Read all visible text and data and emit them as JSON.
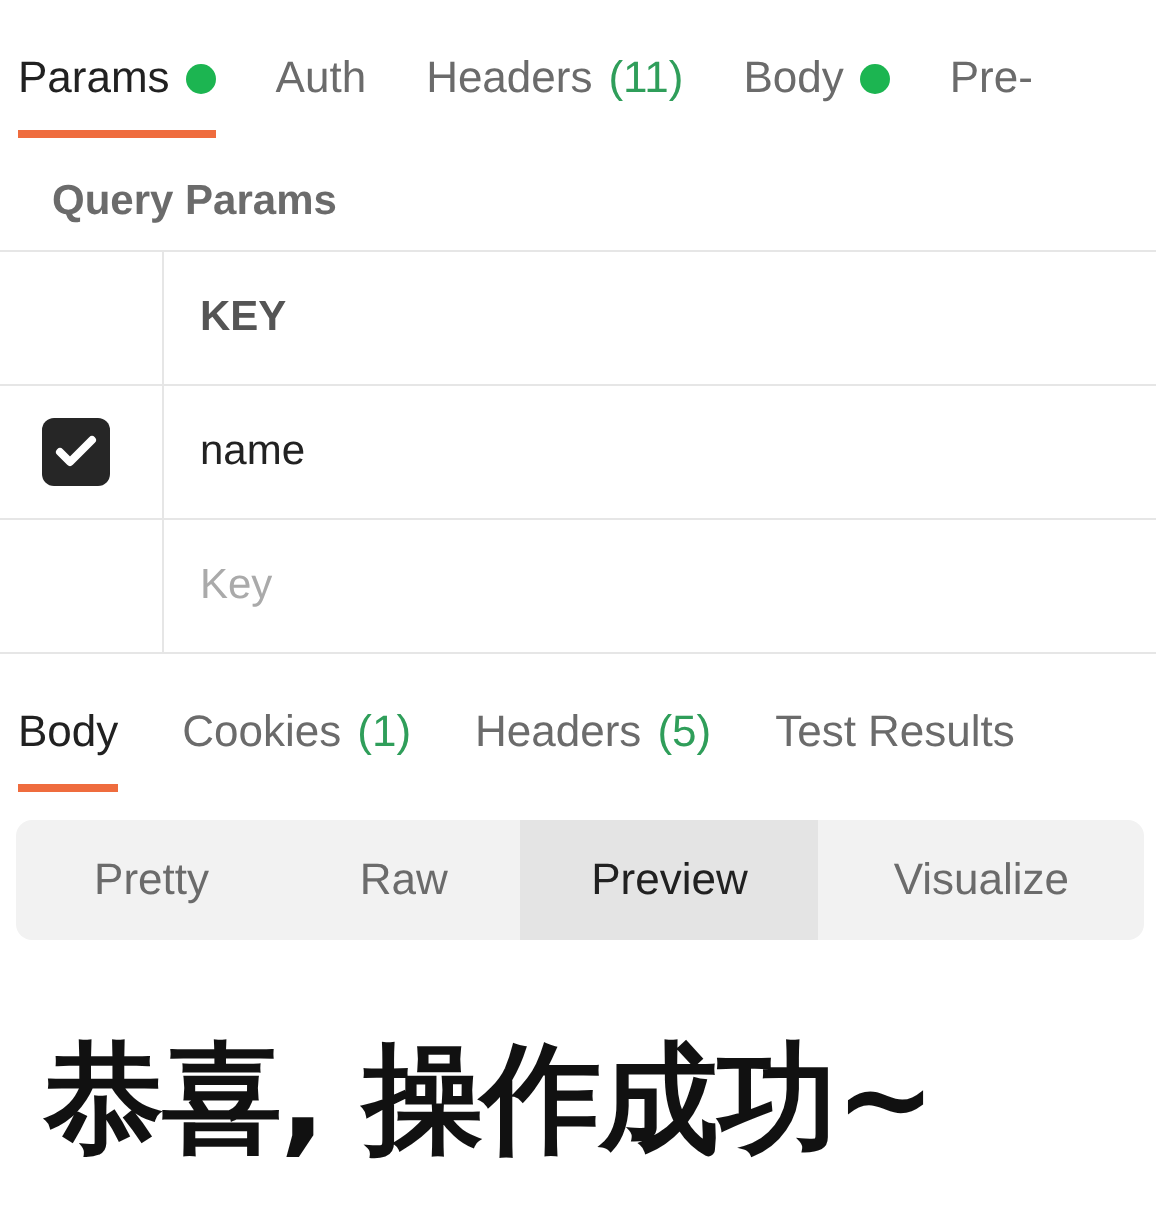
{
  "request_tabs": [
    {
      "label": "Params",
      "dot": true,
      "selected": true
    },
    {
      "label": "Auth",
      "dot": false,
      "selected": false
    },
    {
      "label": "Headers",
      "count": "(11)",
      "dot": false,
      "selected": false
    },
    {
      "label": "Body",
      "dot": true,
      "selected": false
    },
    {
      "label": "Pre-",
      "dot": false,
      "selected": false
    }
  ],
  "query_params": {
    "title": "Query Params",
    "columns": [
      "KEY"
    ],
    "rows": [
      {
        "key": "name",
        "checked": true
      }
    ],
    "new_row": {
      "placeholder": "Key"
    }
  },
  "response_tabs": [
    {
      "label": "Body",
      "dot": false,
      "selected": true
    },
    {
      "label": "Cookies",
      "count": "(1)",
      "dot": false,
      "selected": false
    },
    {
      "label": "Headers",
      "count": "(5)",
      "dot": false,
      "selected": false
    },
    {
      "label": "Test Results",
      "dot": false,
      "selected": false
    }
  ],
  "view_modes": [
    {
      "label": "Pretty",
      "selected": false
    },
    {
      "label": "Raw",
      "selected": false
    },
    {
      "label": "Preview",
      "selected": true
    },
    {
      "label": "Visualize",
      "selected": false
    }
  ],
  "preview": {
    "text": "恭喜, 操作成功~"
  }
}
